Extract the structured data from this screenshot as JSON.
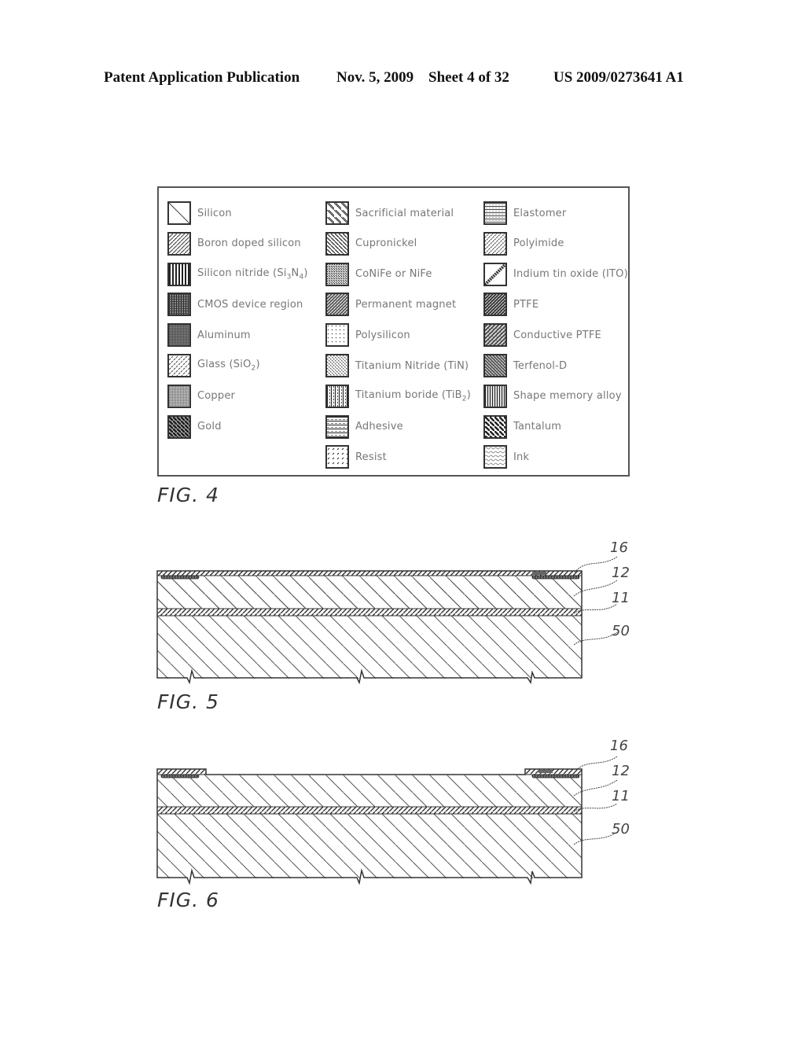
{
  "header": {
    "publication": "Patent Application Publication",
    "date": "Nov. 5, 2009",
    "sheet": "Sheet 4 of 32",
    "number": "US 2009/0273641 A1"
  },
  "legend": {
    "columns": [
      [
        {
          "label": "Silicon",
          "pattern": "silicon"
        },
        {
          "label": "Boron doped silicon",
          "pattern": "boron"
        },
        {
          "label": "Silicon nitride (Si3N4)",
          "pattern": "nitride"
        },
        {
          "label": "CMOS device region",
          "pattern": "cmos"
        },
        {
          "label": "Aluminum",
          "pattern": "aluminum"
        },
        {
          "label": "Glass (SiO2)",
          "pattern": "glass"
        },
        {
          "label": "Copper",
          "pattern": "copper"
        },
        {
          "label": "Gold",
          "pattern": "gold"
        }
      ],
      [
        {
          "label": "Sacrificial material",
          "pattern": "sacrificial"
        },
        {
          "label": "Cupronickel",
          "pattern": "cupronickel"
        },
        {
          "label": "CoNiFe or NiFe",
          "pattern": "conife"
        },
        {
          "label": "Permanent magnet",
          "pattern": "magnet"
        },
        {
          "label": "Polysilicon",
          "pattern": "polysilicon"
        },
        {
          "label": "Titanium Nitride (TiN)",
          "pattern": "tin"
        },
        {
          "label": "Titanium boride (TiB2)",
          "pattern": "tib"
        },
        {
          "label": "Adhesive",
          "pattern": "adhesive"
        },
        {
          "label": "Resist",
          "pattern": "resist"
        }
      ],
      [
        {
          "label": "Elastomer",
          "pattern": "elastomer"
        },
        {
          "label": "Polyimide",
          "pattern": "polyimide"
        },
        {
          "label": "Indium tin oxide (ITO)",
          "pattern": "ito"
        },
        {
          "label": "PTFE",
          "pattern": "ptfe"
        },
        {
          "label": "Conductive PTFE",
          "pattern": "cptfe"
        },
        {
          "label": "Terfenol-D",
          "pattern": "terfenol"
        },
        {
          "label": "Shape memory alloy",
          "pattern": "sma"
        },
        {
          "label": "Tantalum",
          "pattern": "tantalum"
        },
        {
          "label": "Ink",
          "pattern": "ink"
        }
      ]
    ]
  },
  "figures": {
    "fig4": {
      "caption": "FIG. 4"
    },
    "fig5": {
      "caption": "FIG. 5",
      "refs": [
        "16",
        "12",
        "11",
        "50"
      ]
    },
    "fig6": {
      "caption": "FIG. 6",
      "refs": [
        "16",
        "12",
        "11",
        "50"
      ]
    }
  }
}
